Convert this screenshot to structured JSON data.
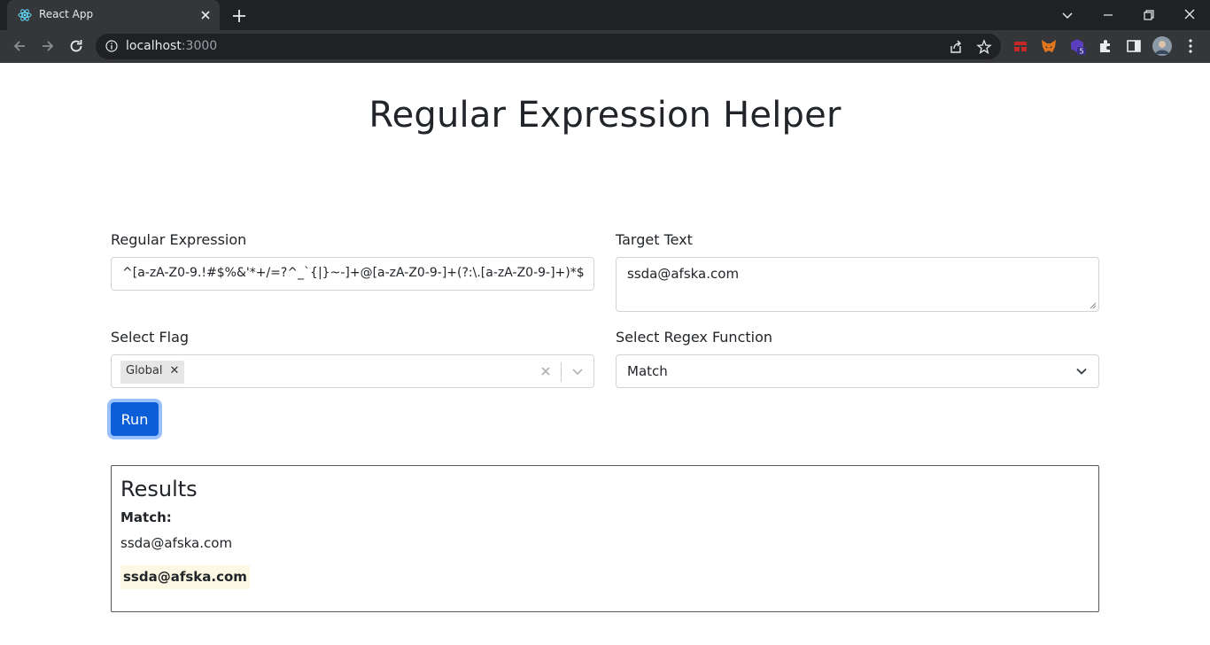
{
  "browser": {
    "tab_title": "React App",
    "url_host": "localhost",
    "url_port": ":3000",
    "extension_badge": "5"
  },
  "page": {
    "title": "Regular Expression Helper",
    "regex_label": "Regular Expression",
    "regex_value": "^[a-zA-Z0-9.!#$%&'*+/=?^_`{|}~-]+@[a-zA-Z0-9-]+(?:\\.[a-zA-Z0-9-]+)*$",
    "target_label": "Target Text",
    "target_value": "ssda@afska.com",
    "flag_label": "Select Flag",
    "flag_chip": "Global",
    "function_label": "Select Regex Function",
    "function_value": "Match",
    "run_label": "Run"
  },
  "results": {
    "title": "Results",
    "match_label": "Match:",
    "match_text": "ssda@afska.com",
    "highlighted": "ssda@afska.com"
  },
  "colors": {
    "primary": "#0b5ed7",
    "highlight": "#fcf8e3",
    "chrome_dark": "#202124",
    "chrome_mid": "#35363a"
  }
}
